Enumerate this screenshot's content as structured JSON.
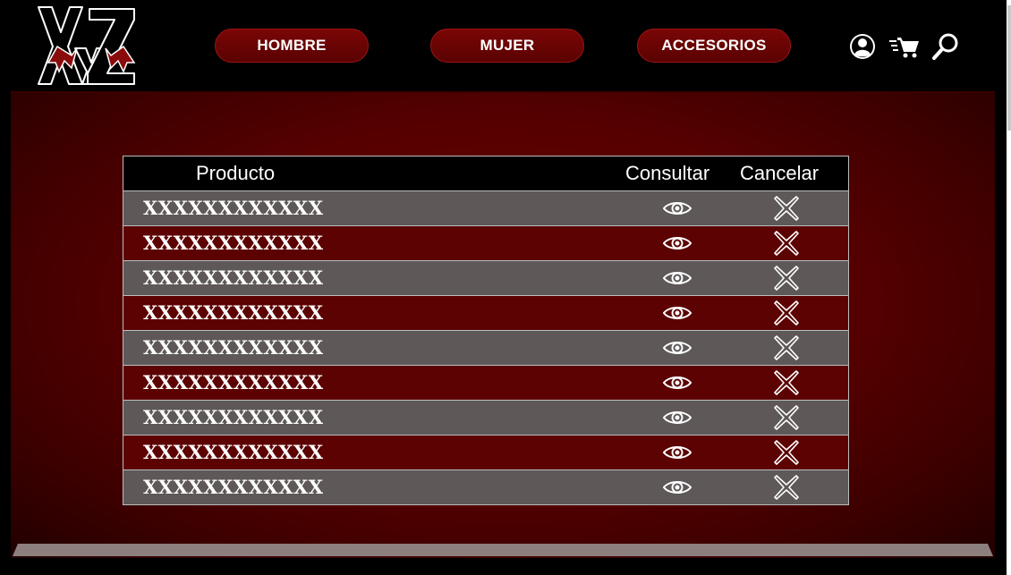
{
  "header": {
    "logo_text": "XyZ",
    "nav": [
      {
        "label": "HOMBRE"
      },
      {
        "label": "MUJER"
      },
      {
        "label": "ACCESORIOS"
      }
    ],
    "icons": [
      "user-icon",
      "cart-icon",
      "search-icon"
    ]
  },
  "table": {
    "columns": {
      "product": "Producto",
      "view": "Consultar",
      "cancel": "Cancelar"
    },
    "rows": [
      {
        "name": "XXXXXXXXXXXX"
      },
      {
        "name": "XXXXXXXXXXXX"
      },
      {
        "name": "XXXXXXXXXXXX"
      },
      {
        "name": "XXXXXXXXXXXX"
      },
      {
        "name": "XXXXXXXXXXXX"
      },
      {
        "name": "XXXXXXXXXXXX"
      },
      {
        "name": "XXXXXXXXXXXX"
      },
      {
        "name": "XXXXXXXXXXXX"
      },
      {
        "name": "XXXXXXXXXXXX"
      }
    ]
  },
  "colors": {
    "accent": "#5c0202",
    "row_alt": "#5e5858",
    "header_bg": "#000000"
  }
}
